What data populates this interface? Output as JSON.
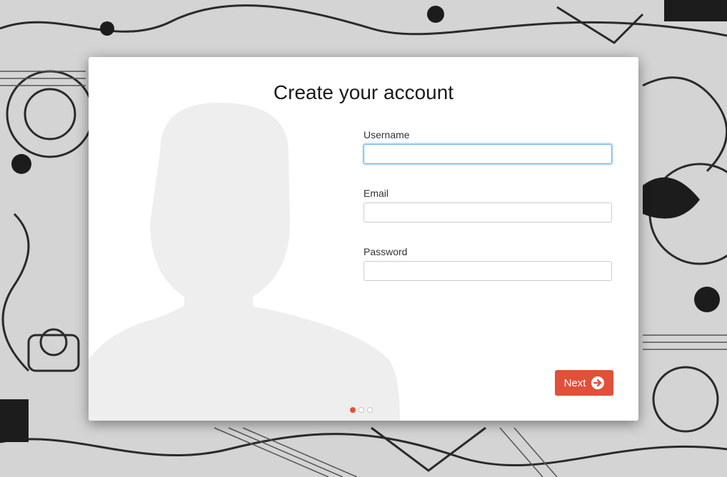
{
  "dialog": {
    "title": "Create your account"
  },
  "form": {
    "username": {
      "label": "Username",
      "value": "",
      "placeholder": ""
    },
    "email": {
      "label": "Email",
      "value": "",
      "placeholder": ""
    },
    "password": {
      "label": "Password",
      "value": "",
      "placeholder": ""
    }
  },
  "actions": {
    "next_label": "Next",
    "next_icon": "arrow-right-icon"
  },
  "pagination": {
    "total_steps": 3,
    "current_step": 1
  },
  "colors": {
    "accent": "#e0503a",
    "focus": "#66afe9",
    "silhouette": "#eeeeee"
  }
}
